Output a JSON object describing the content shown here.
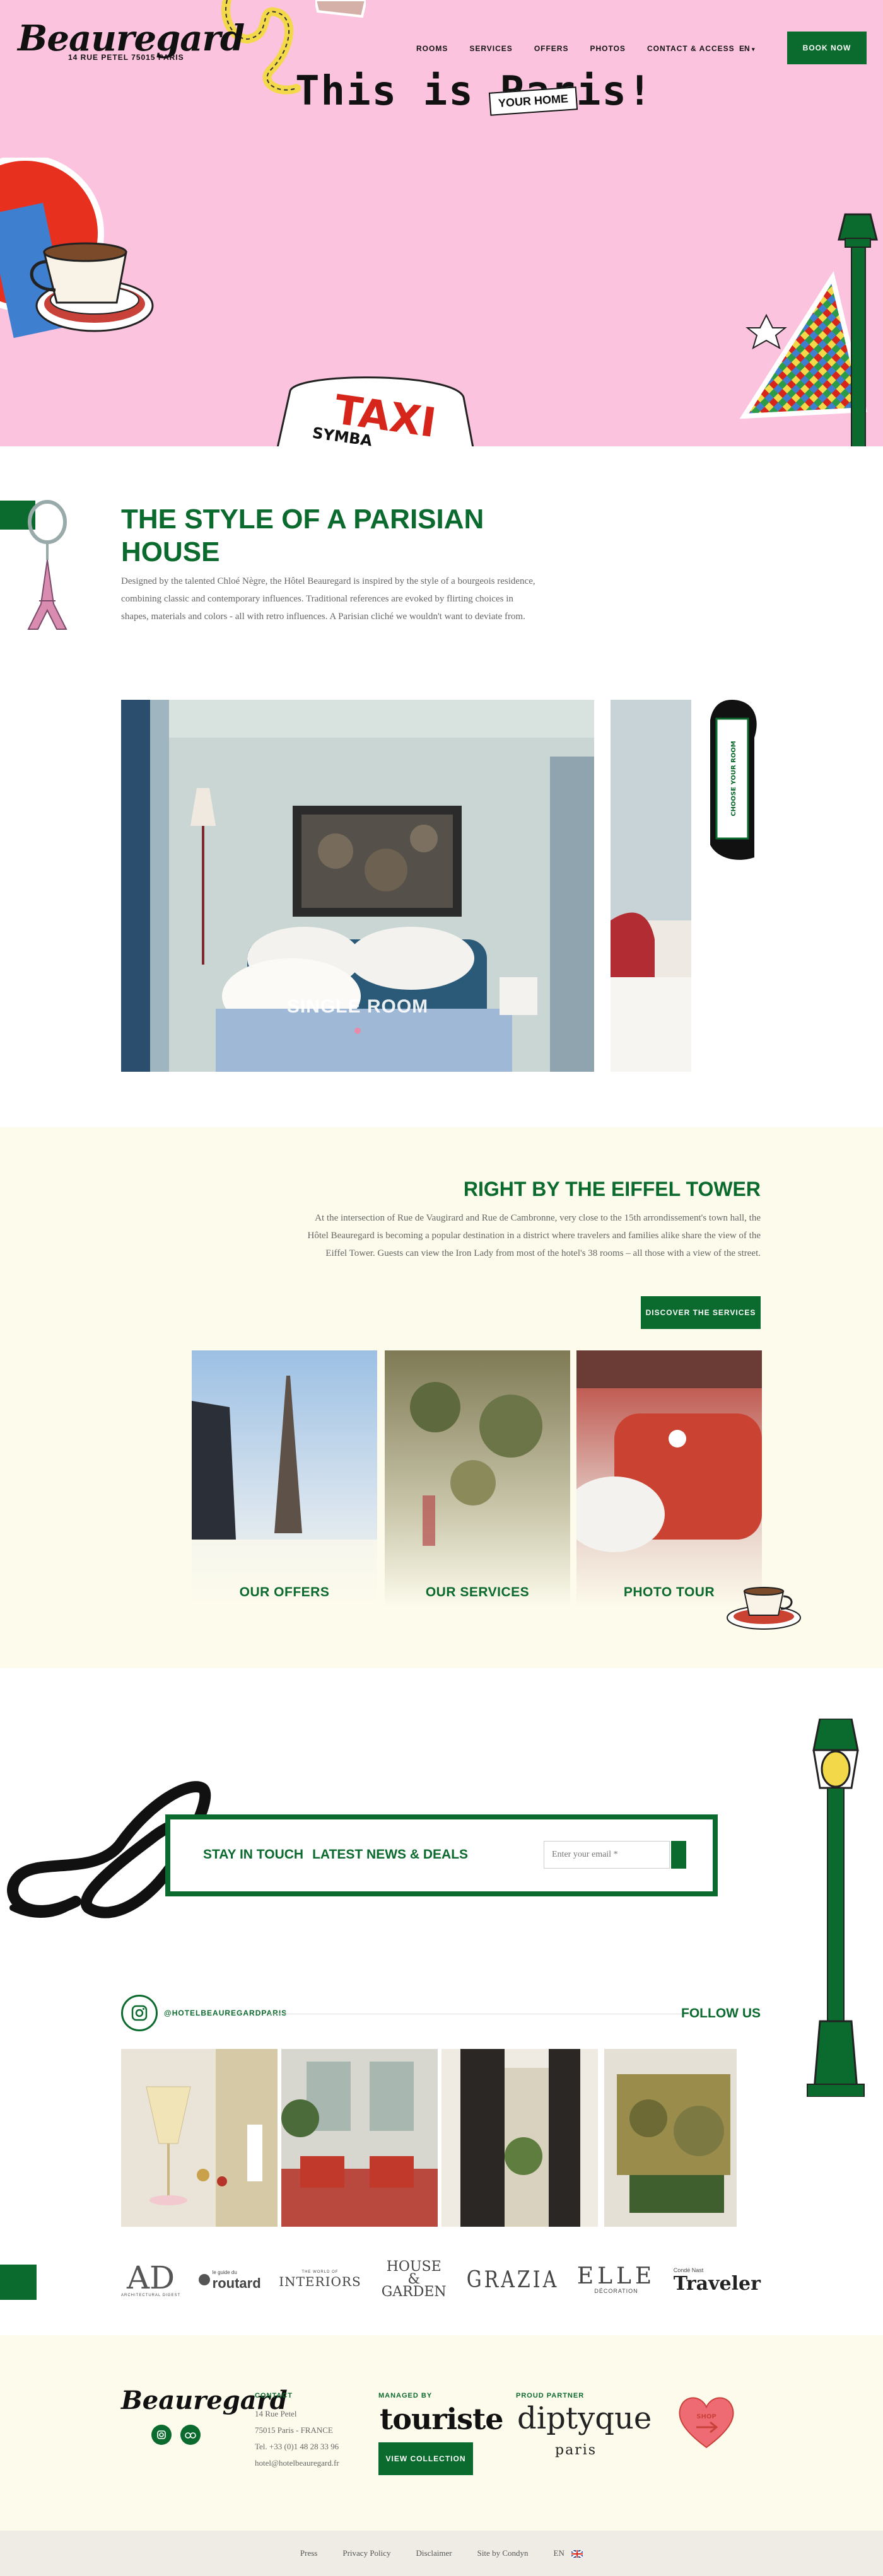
{
  "header": {
    "logo_text": "Beauregard",
    "logo_address": "14 RUE PETEL   75015 PARIS",
    "nav": [
      {
        "label": "ROOMS"
      },
      {
        "label": "SERVICES"
      },
      {
        "label": "OFFERS"
      },
      {
        "label": "PHOTOS"
      },
      {
        "label": "CONTACT & ACCESS"
      }
    ],
    "language": "EN",
    "book_label": "BOOK NOW"
  },
  "hero": {
    "title": "This is Paris!",
    "tag": "YOUR HOME",
    "taxi_sign": "TAXI",
    "taxi_sub": "SYMBA"
  },
  "style_section": {
    "title": "THE STYLE OF A PARISIAN HOUSE",
    "text": "Designed by the talented Chloé Nègre, the Hôtel Beauregard is inspired by the style of a bourgeois residence, combining classic and contemporary influences. Traditional references are evoked by flirting choices in shapes, materials and colors - all with retro influences. A Parisian cliché we wouldn't want to deviate from.",
    "room_label": "SINGLE ROOM",
    "choose_label": "CHOOSE YOUR ROOM"
  },
  "eiffel_section": {
    "title": "RIGHT BY THE EIFFEL TOWER",
    "text": "At the intersection of Rue de Vaugirard and Rue de Cambronne, very close to the 15th arrondissement's town hall, the Hôtel Beauregard is becoming a popular destination in a district where travelers and families alike share the view of the Eiffel Tower. Guests can view the Iron Lady from most of the hotel's 38 rooms – all those with a view of the street.",
    "button_label": "DISCOVER THE SERVICES",
    "cards": [
      {
        "label": "OUR OFFERS"
      },
      {
        "label": "OUR SERVICES"
      },
      {
        "label": "PHOTO TOUR"
      }
    ]
  },
  "newsletter": {
    "label_1": "STAY IN TOUCH",
    "label_2": "LATEST NEWS & DEALS",
    "email_placeholder": "Enter your email *"
  },
  "instagram": {
    "handle": "@HOTELBEAUREGARDPARIS",
    "follow_label": "FOLLOW US"
  },
  "press": [
    {
      "name": "AD",
      "sub": "ARCHITECTURAL DIGEST"
    },
    {
      "name": "routard",
      "sub": "le guide du"
    },
    {
      "name": "INTERIORS",
      "sub": "THE WORLD OF"
    },
    {
      "name": "HOUSE & GARDEN",
      "sub": ""
    },
    {
      "name": "GRAZIA",
      "sub": ""
    },
    {
      "name": "ELLE",
      "sub": "DÉCORATION"
    },
    {
      "name": "Traveler",
      "sub": "Condé Nast"
    }
  ],
  "footer": {
    "logo_text": "Beauregard",
    "contact_title": "CONTACT",
    "contact_lines": [
      "14 Rue Petel",
      "75015 Paris - FRANCE",
      "Tel. +33 (0)1 48 28 33 96",
      "hotel@hotelbeauregard.fr"
    ],
    "managed_title": "MANAGED BY",
    "managed_name": "touriste",
    "view_collection": "VIEW COLLECTION",
    "partner_title": "PROUD PARTNER",
    "partner_name": "diptyque",
    "partner_sub": "paris",
    "shop_label": "SHOP"
  },
  "bottom_bar": {
    "links": [
      "Press",
      "Privacy Policy",
      "Disclaimer",
      "Site by Condyn"
    ],
    "language": "EN"
  },
  "colors": {
    "brand_green": "#0b6a2d",
    "hero_pink": "#fbc3dd",
    "cream": "#fdfbec"
  }
}
